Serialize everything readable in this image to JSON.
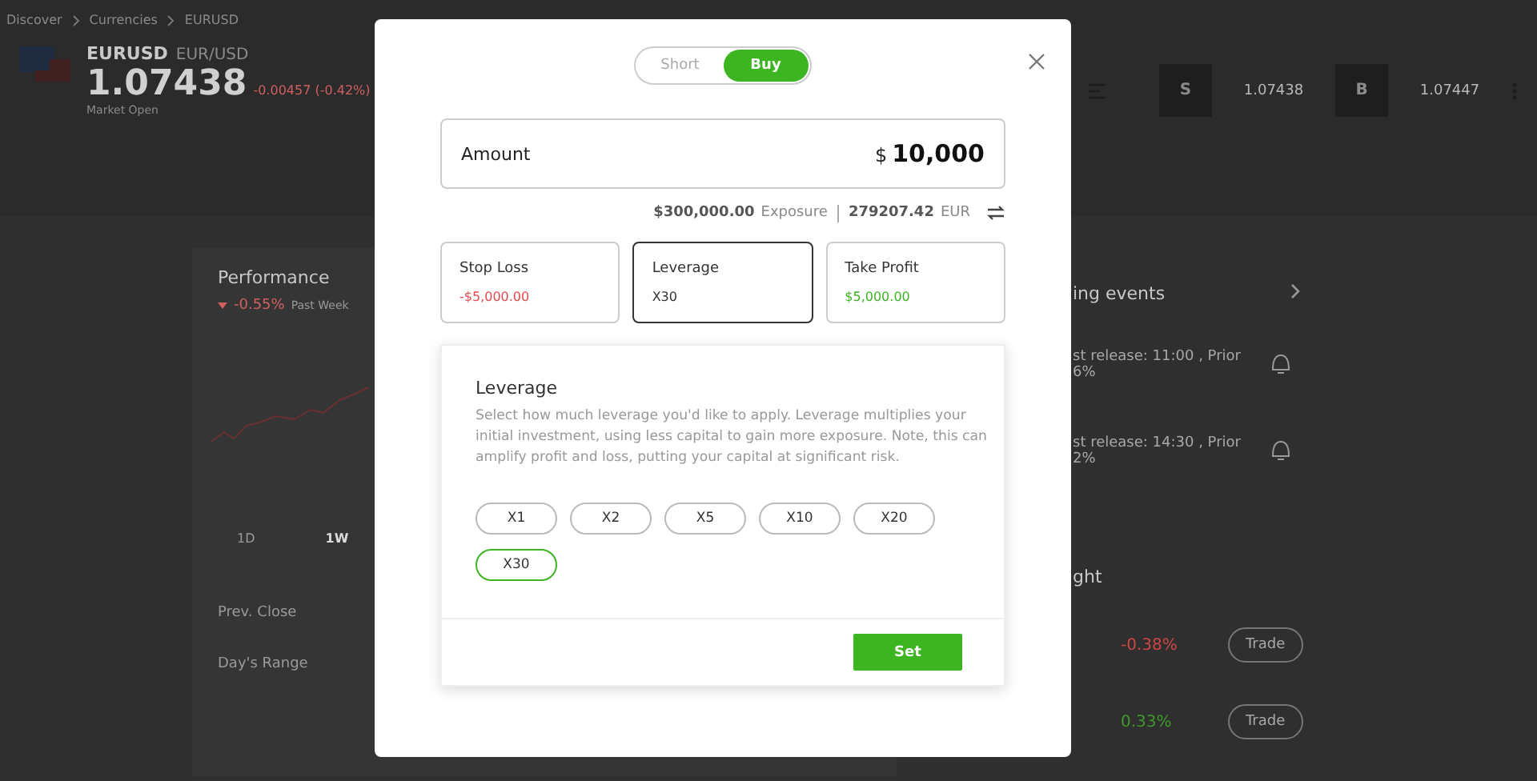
{
  "breadcrumb": [
    "Discover",
    "Currencies",
    "EURUSD"
  ],
  "instrument": {
    "symbol": "EURUSD",
    "pair": "EUR/USD",
    "price": "1.07438",
    "change": "-0.00457 (-0.42%)",
    "status": "Market Open"
  },
  "quote": {
    "sell_label": "S",
    "sell_price": "1.07438",
    "buy_label": "B",
    "buy_price": "1.07447"
  },
  "performance": {
    "title": "Performance",
    "change": "-0.55%",
    "period": "Past Week",
    "ranges": [
      {
        "label": "1D",
        "selected": false
      },
      {
        "label": "1W",
        "selected": true
      }
    ],
    "stats": [
      "Prev. Close",
      "Day's Range"
    ]
  },
  "events": {
    "title": "ing events",
    "items": [
      {
        "text": "st release: 11:00 , Prior",
        "value": "6%"
      },
      {
        "text": "st release: 14:30 , Prior",
        "value": "2%"
      }
    ]
  },
  "insight": {
    "title": "ght",
    "rows": [
      {
        "change": "-0.38%",
        "color": "#d04545",
        "button": "Trade"
      },
      {
        "change": "0.33%",
        "color": "#3f9a2a",
        "button": "Trade"
      }
    ]
  },
  "order": {
    "sides": [
      {
        "label": "Short",
        "selected": false
      },
      {
        "label": "Buy",
        "selected": true
      }
    ],
    "amount_label": "Amount",
    "currency": "$",
    "amount": "10,000",
    "exposure_value": "$300,000.00",
    "exposure_label": "Exposure",
    "converted_value": "279207.42",
    "converted_currency": "EUR",
    "settings": [
      {
        "kind": "loss",
        "label": "Stop Loss",
        "value": "-$5,000.00",
        "selected": false
      },
      {
        "kind": "leverage",
        "label": "Leverage",
        "value": "X30",
        "selected": true
      },
      {
        "kind": "profit",
        "label": "Take Profit",
        "value": "$5,000.00",
        "selected": false
      }
    ],
    "leverage_panel": {
      "title": "Leverage",
      "description": "Select how much leverage you'd like to apply. Leverage multiplies your initial investment, using less capital to gain more exposure. Note, this can amplify profit and loss, putting your capital at significant risk.",
      "options": [
        {
          "label": "X1",
          "selected": false
        },
        {
          "label": "X2",
          "selected": false
        },
        {
          "label": "X5",
          "selected": false
        },
        {
          "label": "X10",
          "selected": false
        },
        {
          "label": "X20",
          "selected": false
        },
        {
          "label": "X30",
          "selected": true
        }
      ],
      "set_button": "Set"
    }
  }
}
